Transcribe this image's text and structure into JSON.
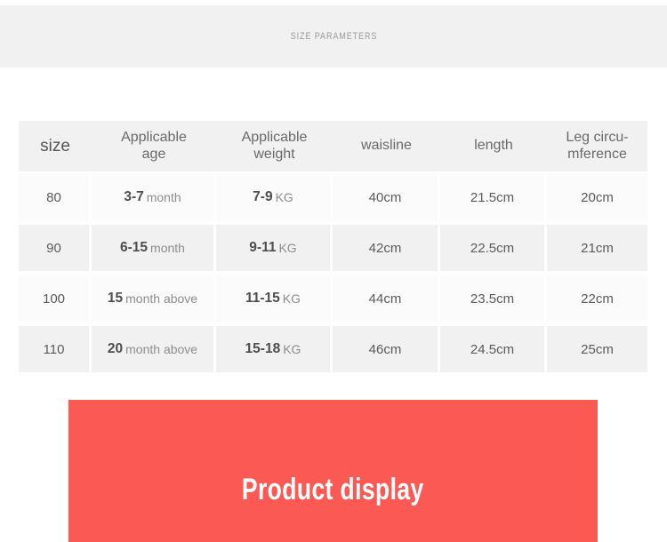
{
  "section": {
    "title": "SIZE PARAMETERS"
  },
  "table": {
    "headers": [
      {
        "label": "size",
        "lines": [
          "size"
        ]
      },
      {
        "label": "Applicable age",
        "lines": [
          "Applicable",
          "age"
        ]
      },
      {
        "label": "Applicable weight",
        "lines": [
          "Applicable",
          "weight"
        ]
      },
      {
        "label": "waisline",
        "lines": [
          "waisline"
        ]
      },
      {
        "label": "length",
        "lines": [
          "length"
        ]
      },
      {
        "label": "Leg circumference",
        "lines": [
          "Leg circu-",
          "mference"
        ]
      }
    ],
    "rows": [
      {
        "size": "80",
        "age_num": "3-7",
        "age_unit": "month",
        "weight_num": "7-9",
        "weight_unit": "KG",
        "waisline": "40cm",
        "length": "21.5cm",
        "leg": "20cm"
      },
      {
        "size": "90",
        "age_num": "6-15",
        "age_unit": "month",
        "weight_num": "9-11",
        "weight_unit": "KG",
        "waisline": "42cm",
        "length": "22.5cm",
        "leg": "21cm"
      },
      {
        "size": "100",
        "age_num": "15",
        "age_unit": "month above",
        "weight_num": "11-15",
        "weight_unit": "KG",
        "waisline": "44cm",
        "length": "23.5cm",
        "leg": "22cm"
      },
      {
        "size": "110",
        "age_num": "20",
        "age_unit": "month above",
        "weight_num": "15-18",
        "weight_unit": "KG",
        "waisline": "46cm",
        "length": "24.5cm",
        "leg": "25cm"
      }
    ]
  },
  "product_banner": {
    "title": "Product display",
    "background_color": "#fa5a53",
    "text_color": "#ffffff"
  },
  "colors": {
    "banner_grey": "#f1f1f1",
    "row_light": "#fbfbfb",
    "row_dark": "#f1f1f1",
    "text_grey": "#5b5b5b",
    "unit_grey": "#8d8d8d",
    "accent_red": "#fa5a53"
  }
}
